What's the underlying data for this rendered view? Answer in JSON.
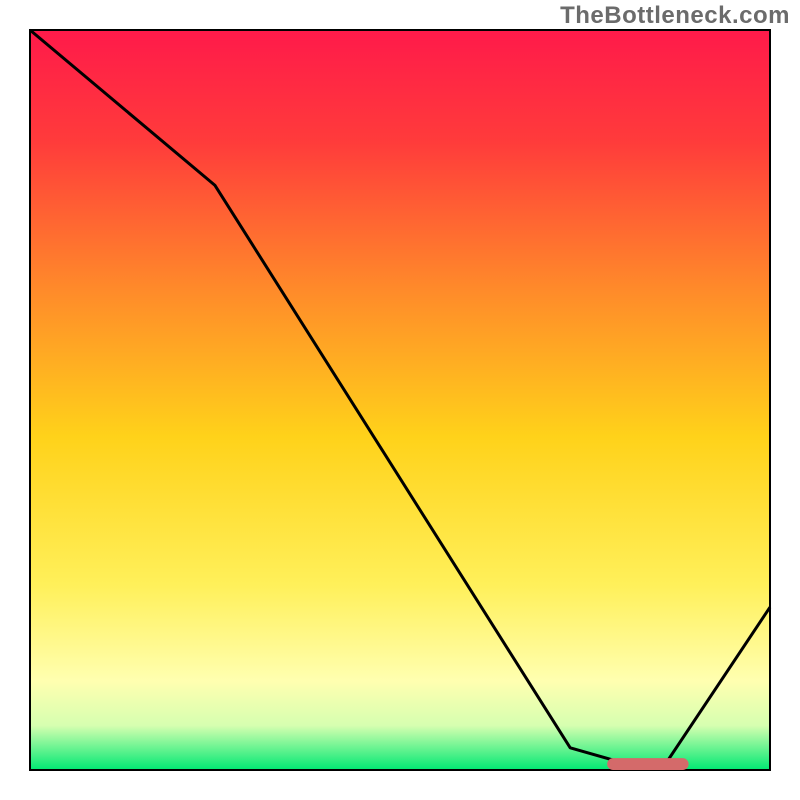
{
  "attribution": "TheBottleneck.com",
  "chart_data": {
    "type": "line",
    "title": "",
    "xlabel": "",
    "ylabel": "",
    "xlim": [
      0,
      100
    ],
    "ylim": [
      0,
      100
    ],
    "grid": false,
    "legend": null,
    "background_gradient": {
      "orientation": "vertical",
      "stops": [
        {
          "offset": 0.0,
          "color": "#ff1a4a"
        },
        {
          "offset": 0.15,
          "color": "#ff3b3b"
        },
        {
          "offset": 0.35,
          "color": "#ff8a2a"
        },
        {
          "offset": 0.55,
          "color": "#ffd21a"
        },
        {
          "offset": 0.75,
          "color": "#fff05a"
        },
        {
          "offset": 0.88,
          "color": "#ffffb0"
        },
        {
          "offset": 0.94,
          "color": "#d6ffb0"
        },
        {
          "offset": 1.0,
          "color": "#00e873"
        }
      ]
    },
    "series": [
      {
        "name": "bottleneck-curve",
        "color": "#000000",
        "x": [
          0,
          25,
          73,
          80,
          86,
          100
        ],
        "values": [
          100,
          79,
          3,
          1,
          1,
          22
        ]
      }
    ],
    "markers": [
      {
        "name": "optimal-range-bar",
        "shape": "rounded-bar",
        "color": "#d46a6a",
        "x_start": 78,
        "x_end": 89,
        "y": 0.8,
        "height": 1.6
      }
    ]
  }
}
